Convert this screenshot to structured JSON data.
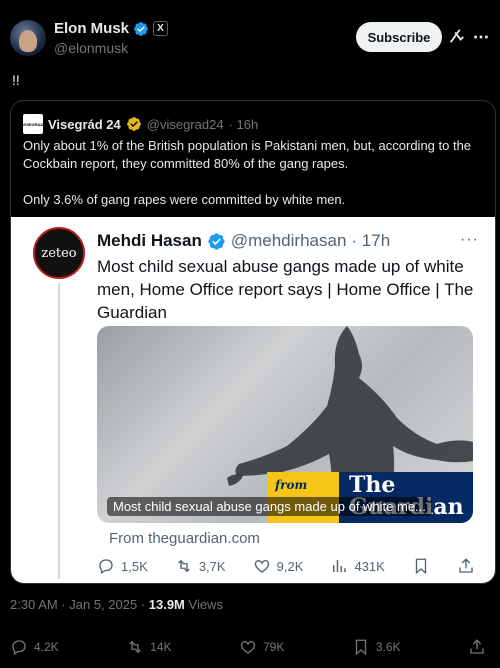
{
  "author": {
    "name": "Elon Musk",
    "handle": "@elonmusk",
    "badge": "X"
  },
  "header": {
    "subscribe_label": "Subscribe"
  },
  "tweet": {
    "text": "!!"
  },
  "quoted": {
    "name": "Visegrád 24",
    "handle": "@visegrad24",
    "time": "· 16h",
    "paragraph1": "Only about 1% of the British population is Pakistani men, but, according to the Cockbain report, they committed 80% of the gang rapes.",
    "paragraph2": "Only 3.6% of gang rapes were committed by white men."
  },
  "inner": {
    "avatar_text": "zeteo",
    "name": "Mehdi Hasan",
    "handle": "@mehdirhasan",
    "time": "· 17h",
    "more": "···",
    "text": "Most child sexual abuse gangs made up of white men, Home Office report says | Home Office | The Guardian",
    "media_caption": "Most child sexual abuse gangs made up of white me...",
    "guardian_from": "from",
    "guardian_logo": "The Guardian",
    "link": "From theguardian.com",
    "replies": "1,5K",
    "reposts": "3,7K",
    "likes": "9,2K",
    "views": "431K"
  },
  "meta": {
    "time": "2:30 AM · Jan 5, 2025 · ",
    "views_count": "13.9M",
    "views_label": " Views"
  },
  "actions": {
    "replies": "4.2K",
    "reposts": "14K",
    "likes": "79K",
    "bookmarks": "3.6K"
  },
  "colors": {
    "background": "#000000",
    "verified": "#1d9bf0",
    "visegrad_verified": "#e2b719",
    "guardian_blue": "#052962",
    "guardian_yellow": "#f5c518"
  }
}
